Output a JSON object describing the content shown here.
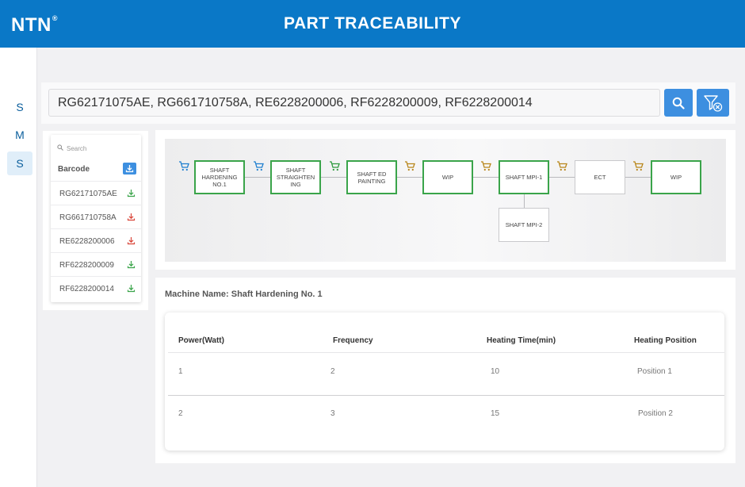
{
  "header": {
    "logo": "NTN",
    "logo_mark": "®",
    "title": "PART TRACEABILITY"
  },
  "rail": {
    "items": [
      "S",
      "M",
      "S"
    ],
    "active_index": 2
  },
  "search": {
    "value": "RG62171075AE, RG661710758A, RE6228200006, RF6228200009, RF6228200014",
    "search_icon": "search-icon",
    "filter_icon": "filter-clear-icon"
  },
  "barcodes": {
    "search_placeholder": "Search",
    "header": "Barcode",
    "items": [
      {
        "code": "RG62171075AE",
        "status": "green"
      },
      {
        "code": "RG661710758A",
        "status": "red"
      },
      {
        "code": "RE6228200006",
        "status": "red"
      },
      {
        "code": "RF6228200009",
        "status": "green"
      },
      {
        "code": "RF6228200014",
        "status": "green"
      }
    ]
  },
  "flow": {
    "nodes": [
      {
        "label": "SHAFT HARDENING NO.1",
        "style": "green"
      },
      {
        "label": "SHAFT STRAIGHTEN ING",
        "style": "green"
      },
      {
        "label": "SHAFT ED PAINTING",
        "style": "green"
      },
      {
        "label": "WIP",
        "style": "green"
      },
      {
        "label": "SHAFT MPI-1",
        "style": "green"
      },
      {
        "label": "ECT",
        "style": "gray"
      },
      {
        "label": "WIP",
        "style": "green"
      },
      {
        "label": "SHAFT MPI-2",
        "style": "gray"
      }
    ],
    "carts": [
      "blue",
      "blue",
      "green",
      "orange",
      "orange",
      "orange",
      "orange"
    ]
  },
  "machine": {
    "label": "Machine Name: Shaft Hardening No. 1",
    "columns": [
      "Power(Watt)",
      "Frequency",
      "Heating Time(min)",
      "Heating Position"
    ],
    "rows": [
      [
        "1",
        "2",
        "10",
        "Position 1"
      ],
      [
        "2",
        "3",
        "15",
        "Position 2"
      ]
    ]
  },
  "colors": {
    "brand": "#0a78c7",
    "button": "#3d8fe0",
    "node_green": "#3aa44a",
    "cart_blue": "#1f7fd0",
    "cart_green": "#2e9a3e",
    "cart_orange": "#b8861a",
    "download_green": "#3aa44a",
    "download_red": "#d9463a"
  }
}
